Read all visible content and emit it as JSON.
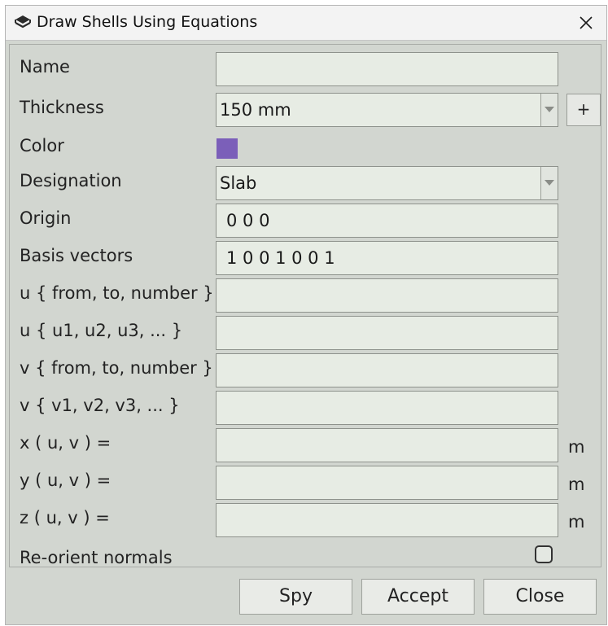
{
  "window": {
    "title": "Draw Shells Using Equations"
  },
  "form": {
    "name": {
      "label": "Name",
      "value": ""
    },
    "thickness": {
      "label": "Thickness",
      "value": "150 mm",
      "add_label": "+"
    },
    "color": {
      "label": "Color",
      "swatch": "#7b5fb9"
    },
    "designation": {
      "label": "Designation",
      "value": "Slab"
    },
    "origin": {
      "label": "Origin",
      "value": "0 0 0"
    },
    "basis": {
      "label": "Basis vectors",
      "value": "1 0 0 1 0 0 1"
    },
    "u_range": {
      "label": "u { from, to, number }",
      "value": ""
    },
    "u_list": {
      "label": "u { u1, u2, u3, ... }",
      "value": ""
    },
    "v_range": {
      "label": "v { from, to, number }",
      "value": ""
    },
    "v_list": {
      "label": "v { v1, v2, v3, ... }",
      "value": ""
    },
    "x_eq": {
      "label": "x ( u, v ) =",
      "value": "",
      "unit": "m"
    },
    "y_eq": {
      "label": "y ( u, v ) =",
      "value": "",
      "unit": "m"
    },
    "z_eq": {
      "label": "z ( u, v ) =",
      "value": "",
      "unit": "m"
    },
    "reorient": {
      "label": "Re-orient normals",
      "checked": false
    }
  },
  "buttons": {
    "spy": "Spy",
    "accept": "Accept",
    "close": "Close"
  }
}
